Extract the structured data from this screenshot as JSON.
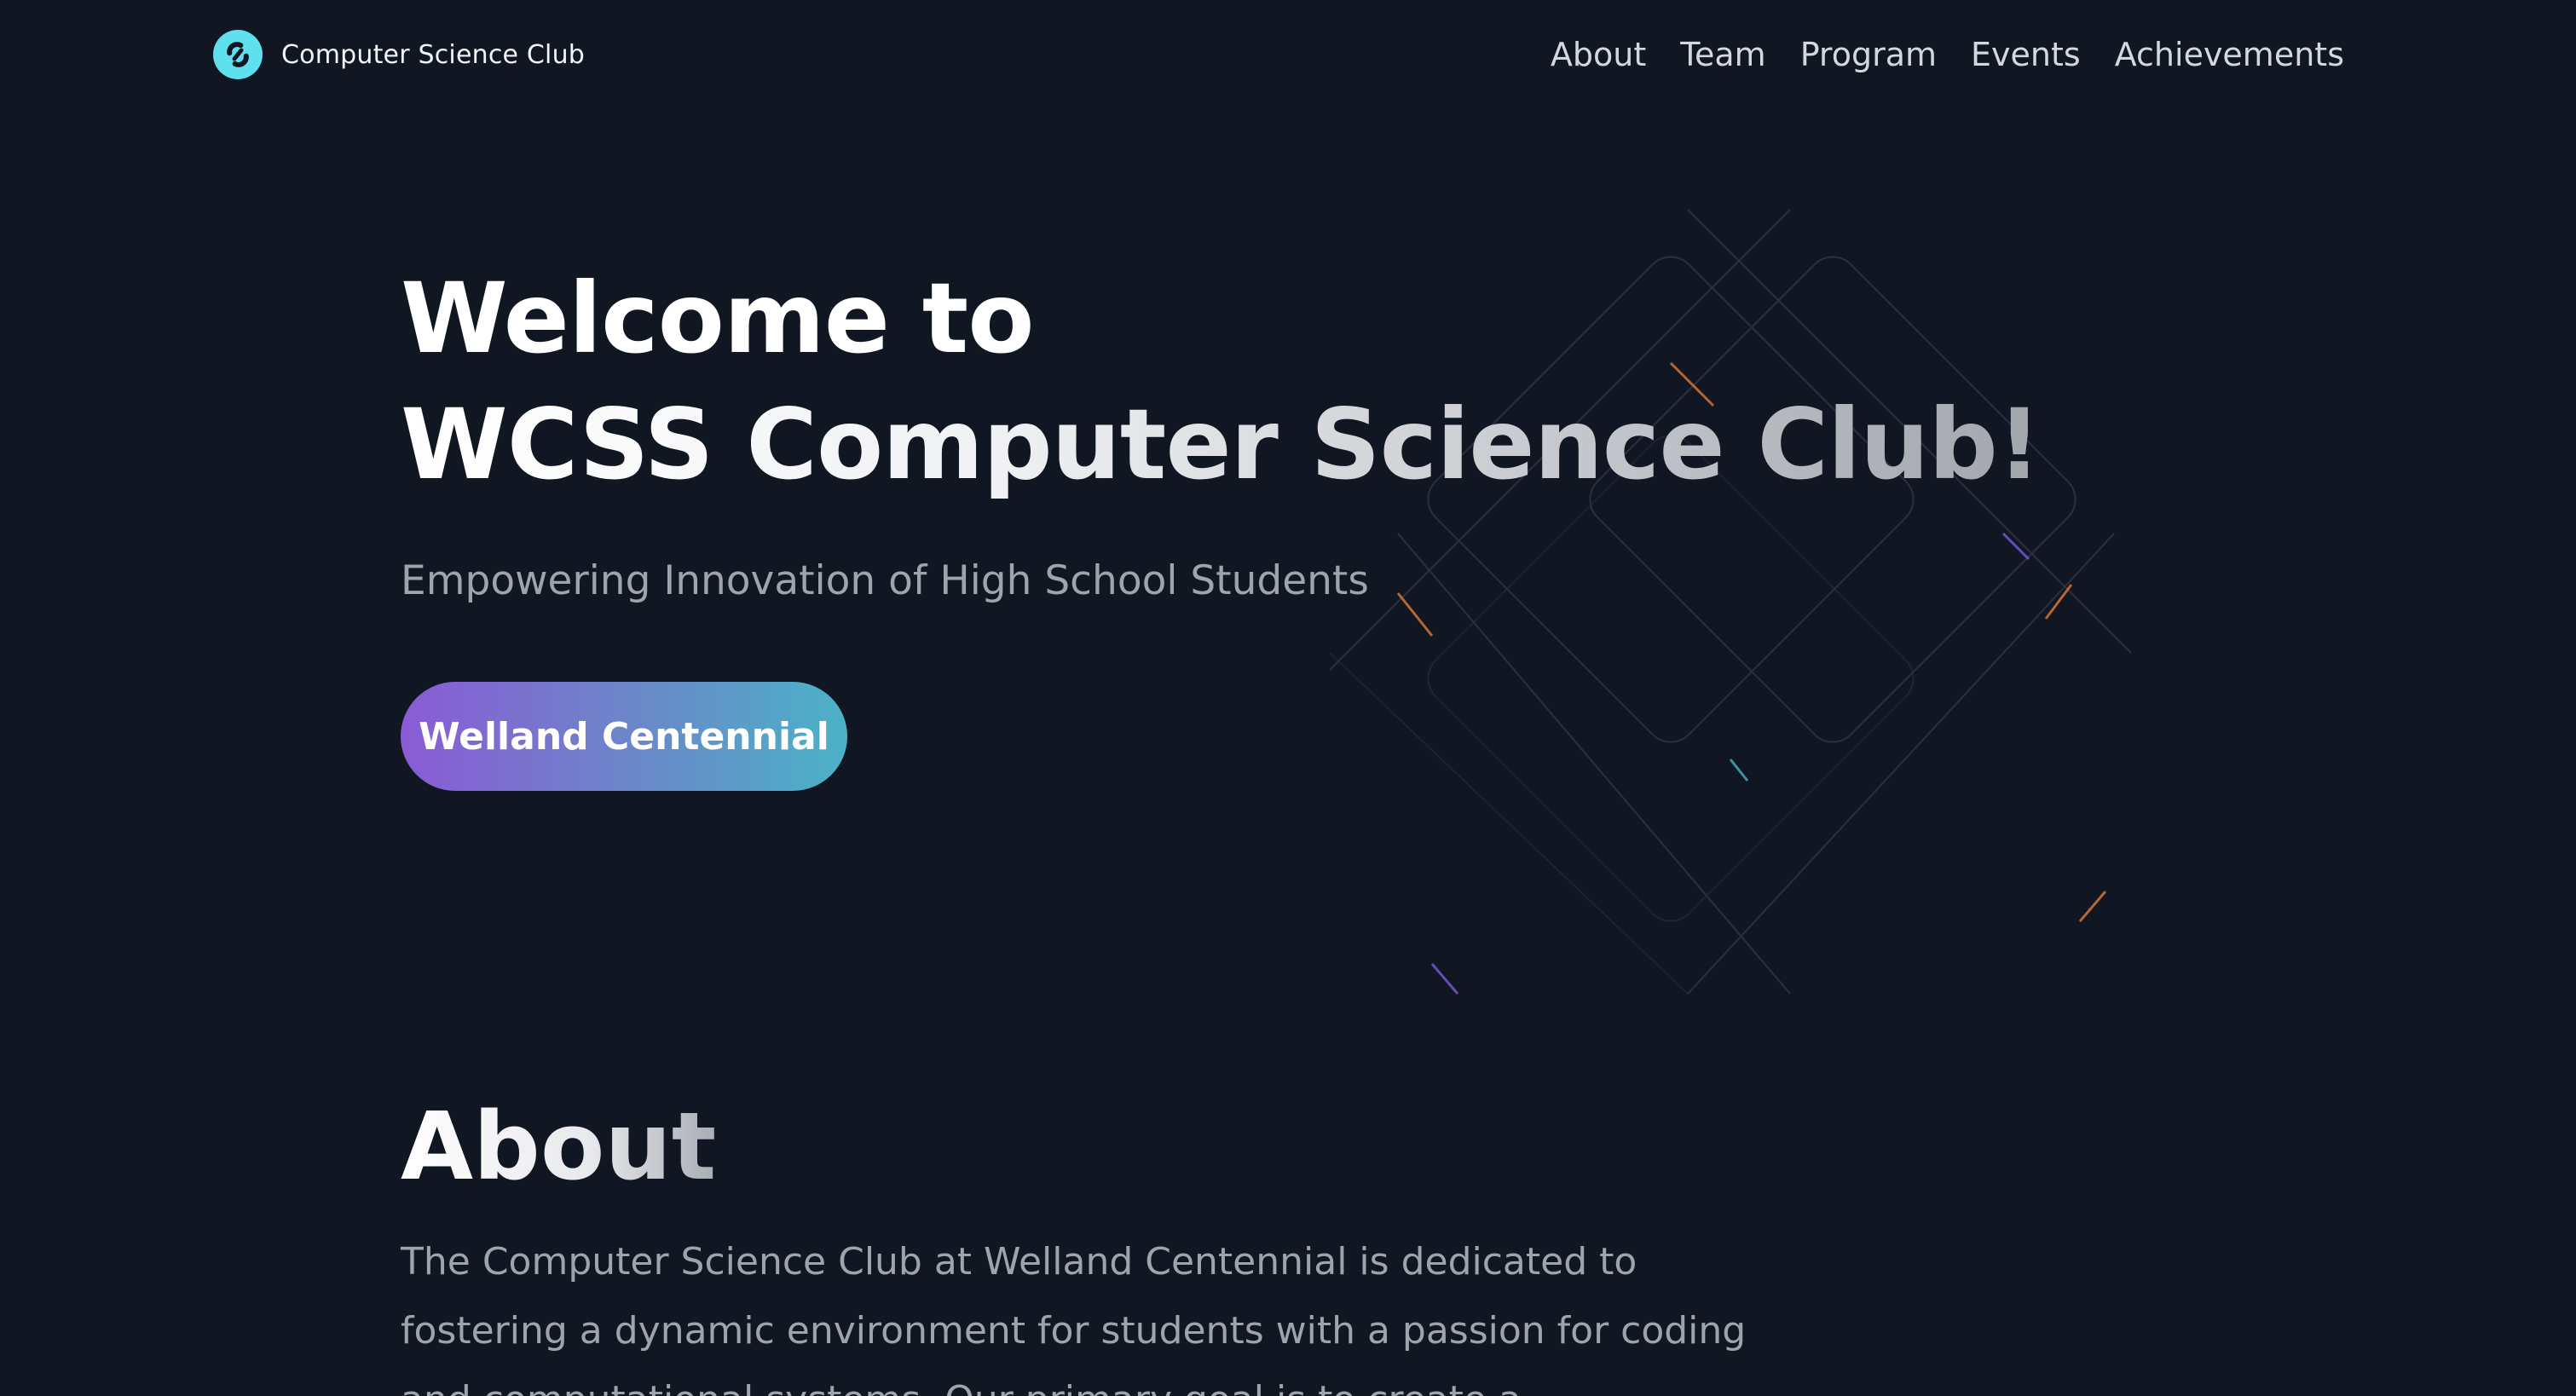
{
  "nav": {
    "brand": "Computer Science Club",
    "links": [
      "About",
      "Team",
      "Program",
      "Events",
      "Achievements"
    ]
  },
  "hero": {
    "title_line1": "Welcome to",
    "title_line2": "WCSS Computer Science Club!",
    "subtitle": "Empowering Innovation of High School Students",
    "button": "Welland Centennial"
  },
  "about": {
    "title": "About",
    "text": "The Computer Science Club at Welland Centennial is dedicated to fostering a dynamic environment for students with a passion for coding and computational systems. Our primary goal is to create a"
  },
  "colors": {
    "background": "#111623",
    "accent_cyan": "#5fe0ee",
    "gradient_start": "#8a5bd6",
    "gradient_end": "#4bb2c7"
  },
  "icons": {
    "logo": "link-logo-icon"
  }
}
